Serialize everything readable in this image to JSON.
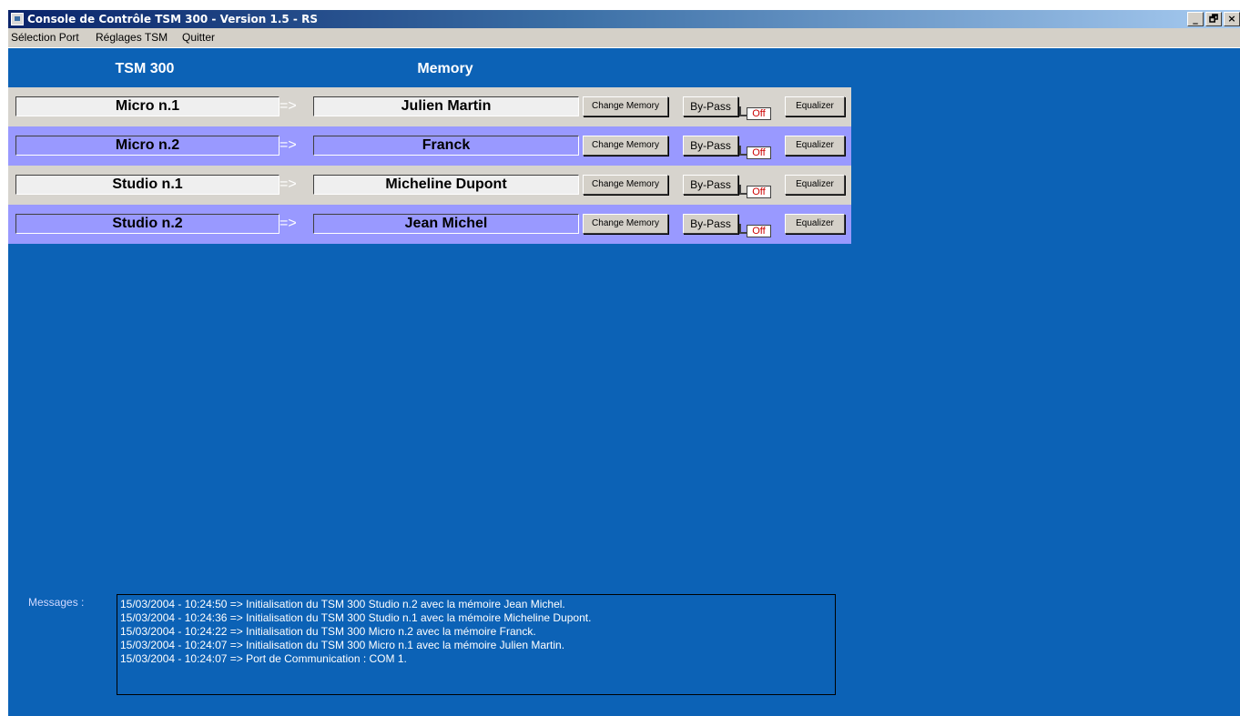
{
  "window": {
    "title": "Console de Contrôle TSM 300 - Version 1.5 - RS",
    "controls": {
      "minimize": "_",
      "restore": "🗗",
      "close": "×"
    }
  },
  "menu": {
    "items": [
      "Sélection Port",
      "Réglages TSM",
      "Quitter"
    ]
  },
  "headers": {
    "left": "TSM 300",
    "right": "Memory"
  },
  "rows": [
    {
      "device": "Micro n.1",
      "arrow": "=>",
      "memory": "Julien Martin",
      "change": "Change Memory",
      "bypass": "By-Pass",
      "state": "Off",
      "equalizer": "Equalizer"
    },
    {
      "device": "Micro n.2",
      "arrow": "=>",
      "memory": "Franck",
      "change": "Change Memory",
      "bypass": "By-Pass",
      "state": "Off",
      "equalizer": "Equalizer"
    },
    {
      "device": "Studio n.1",
      "arrow": "=>",
      "memory": "Micheline Dupont",
      "change": "Change Memory",
      "bypass": "By-Pass",
      "state": "Off",
      "equalizer": "Equalizer"
    },
    {
      "device": "Studio n.2",
      "arrow": "=>",
      "memory": "Jean Michel",
      "change": "Change Memory",
      "bypass": "By-Pass",
      "state": "Off",
      "equalizer": "Equalizer"
    }
  ],
  "messages": {
    "label": "Messages :",
    "lines": [
      "15/03/2004 - 10:24:50 => Initialisation du TSM 300 Studio n.2 avec la mémoire Jean Michel.",
      "15/03/2004 - 10:24:36 => Initialisation du TSM 300 Studio n.1 avec la mémoire Micheline Dupont.",
      "15/03/2004 - 10:24:22 => Initialisation du TSM 300 Micro n.2  avec la mémoire Franck.",
      "15/03/2004 - 10:24:07 => Initialisation du TSM 300 Micro n.1  avec la mémoire Julien Martin.",
      "15/03/2004 - 10:24:07 => Port de Communication : COM 1."
    ]
  },
  "colors": {
    "background": "#0c62b6",
    "row_light": "#d7d4ce",
    "row_dark": "#9999ff",
    "off_text": "#cc0000"
  }
}
